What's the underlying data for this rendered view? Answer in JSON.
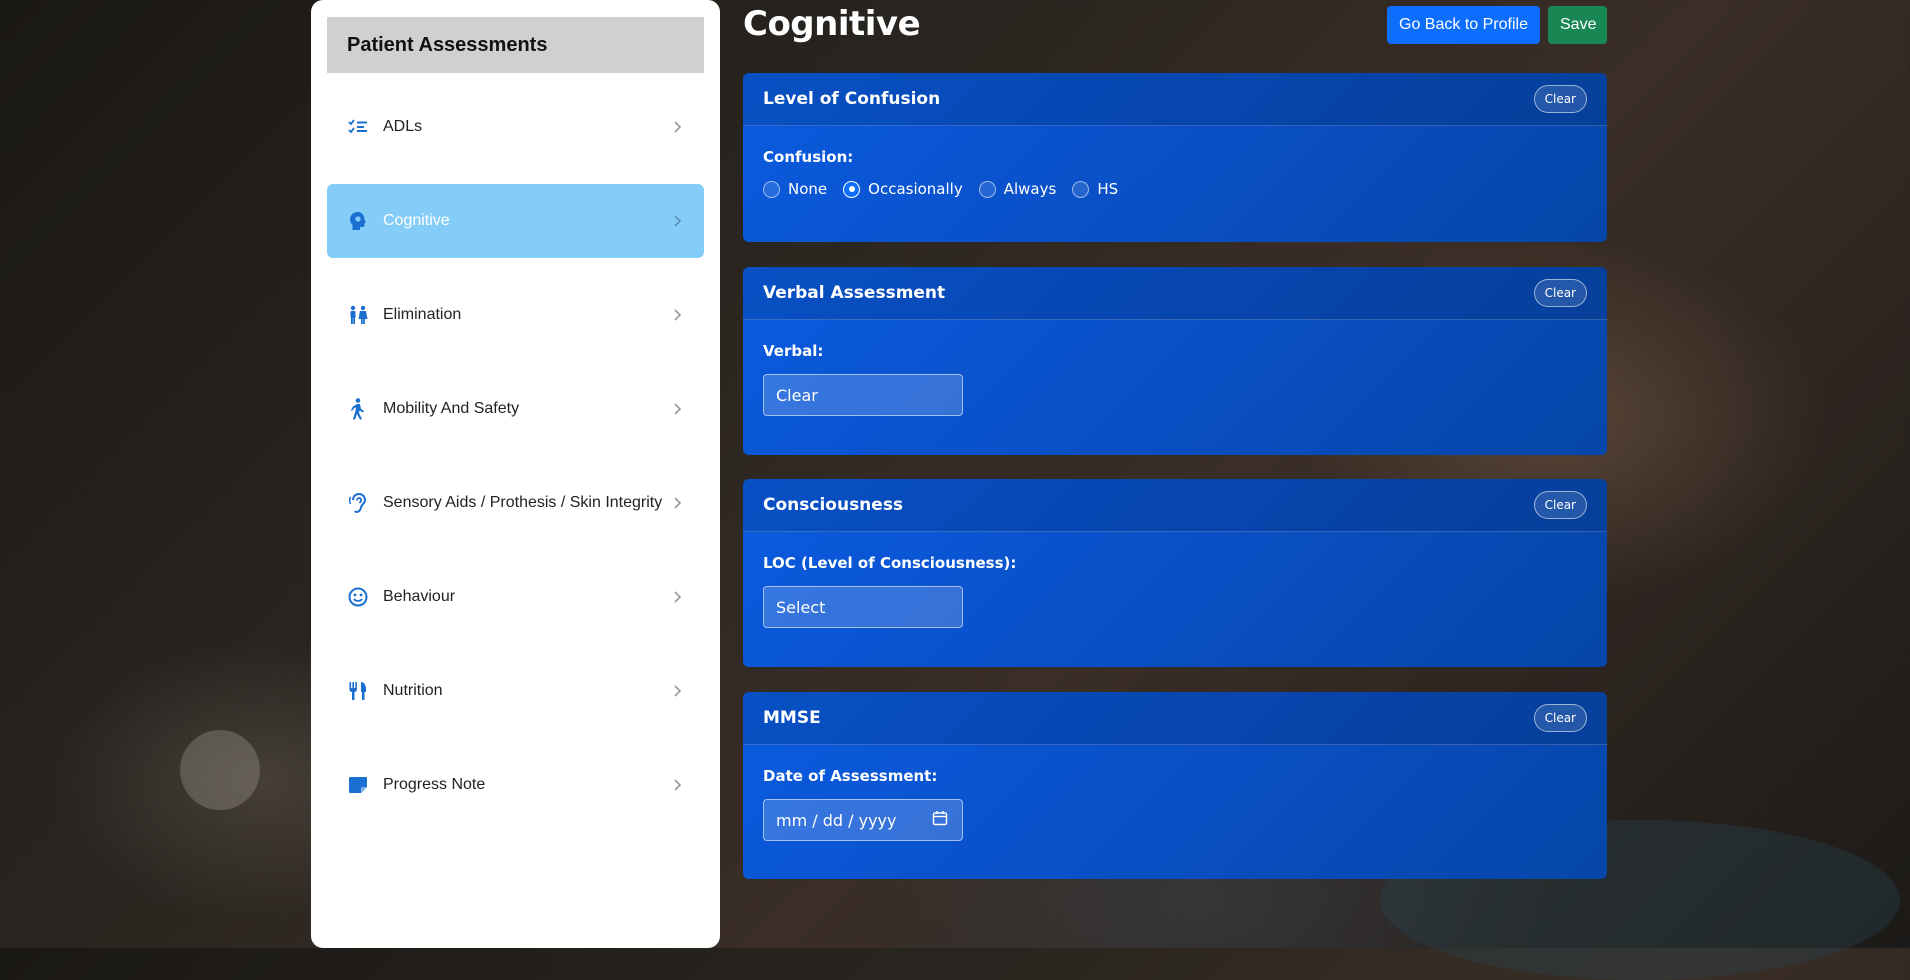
{
  "sidebar": {
    "title": "Patient Assessments",
    "items": [
      {
        "label": "ADLs",
        "icon": "checklist-icon"
      },
      {
        "label": "Cognitive",
        "icon": "brain-head-icon",
        "active": true
      },
      {
        "label": "Elimination",
        "icon": "restroom-icon"
      },
      {
        "label": "Mobility And Safety",
        "icon": "walking-person-icon"
      },
      {
        "label": "Sensory Aids / Prothesis / Skin Integrity",
        "icon": "hearing-icon"
      },
      {
        "label": "Behaviour",
        "icon": "smile-icon"
      },
      {
        "label": "Nutrition",
        "icon": "fork-knife-icon"
      },
      {
        "label": "Progress Note",
        "icon": "note-icon"
      }
    ]
  },
  "main": {
    "title": "Cognitive",
    "back_label": "Go Back to Profile",
    "save_label": "Save"
  },
  "cards": {
    "confusion": {
      "title": "Level of Confusion",
      "clear": "Clear",
      "field_label": "Confusion:",
      "options": [
        "None",
        "Occasionally",
        "Always",
        "HS"
      ],
      "selected": "Occasionally"
    },
    "verbal": {
      "title": "Verbal Assessment",
      "clear": "Clear",
      "field_label": "Verbal:",
      "value": "Clear"
    },
    "consciousness": {
      "title": "Consciousness",
      "clear": "Clear",
      "field_label": "LOC (Level of Consciousness):",
      "value": "Select"
    },
    "mmse": {
      "title": "MMSE",
      "clear": "Clear",
      "field_label": "Date of Assessment:",
      "placeholder": "mm / dd / yyyy"
    }
  },
  "colors": {
    "accent": "#0d6efd",
    "save": "#198754",
    "active_item": "#85cdf9",
    "card": "#0a54d0",
    "icon_blue": "#1a6fd1"
  }
}
